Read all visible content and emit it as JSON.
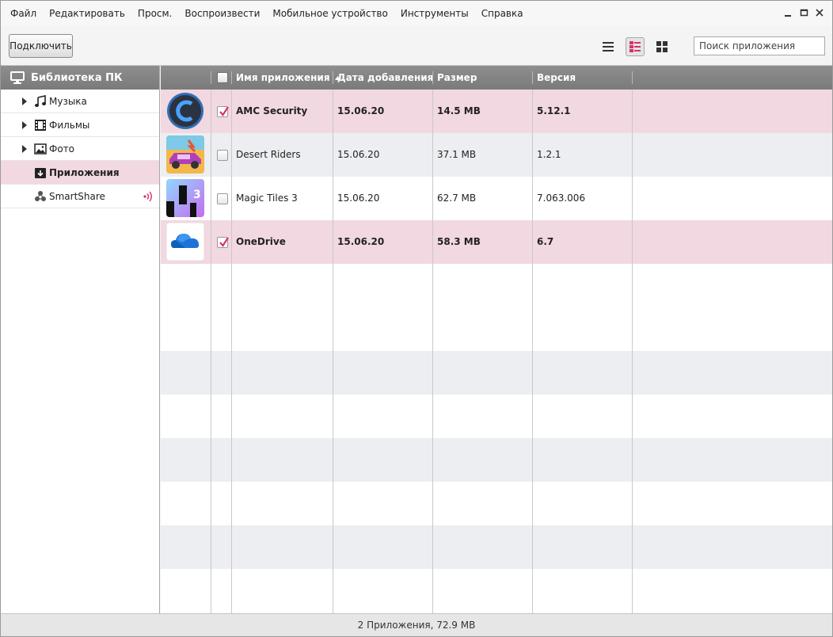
{
  "menu": [
    "Файл",
    "Редактировать",
    "Просм.",
    "Воспроизвести",
    "Мобильное устройство",
    "Инструменты",
    "Справка"
  ],
  "toolbar": {
    "connect_label": "Подключить",
    "search_placeholder": "Поиск приложения"
  },
  "sidebar": {
    "header": "Библиотека ПК",
    "items": [
      {
        "label": "Музыка",
        "icon": "music-icon"
      },
      {
        "label": "Фильмы",
        "icon": "film-icon"
      },
      {
        "label": "Фото",
        "icon": "photo-icon"
      },
      {
        "label": "Приложения",
        "icon": "apps-icon",
        "selected": true
      },
      {
        "label": "SmartShare",
        "icon": "smartshare-icon"
      }
    ]
  },
  "table": {
    "columns": [
      "Имя приложения",
      "Дата добавления",
      "Размер",
      "Версия"
    ],
    "rows": [
      {
        "name": "AMC Security",
        "date": "15.06.20",
        "size": "14.5 MB",
        "version": "5.12.1",
        "checked": true
      },
      {
        "name": "Desert Riders",
        "date": "15.06.20",
        "size": "37.1 MB",
        "version": "1.2.1",
        "checked": false
      },
      {
        "name": "Magic Tiles 3",
        "date": "15.06.20",
        "size": "62.7 MB",
        "version": "7.063.006",
        "checked": false
      },
      {
        "name": "OneDrive",
        "date": "15.06.20",
        "size": "58.3 MB",
        "version": "6.7",
        "checked": true
      }
    ]
  },
  "status": "2 Приложения, 72.9 MB",
  "colors": {
    "accent": "#d6336c",
    "selected_row": "#f2d8e0",
    "header_gray": "#858585"
  }
}
